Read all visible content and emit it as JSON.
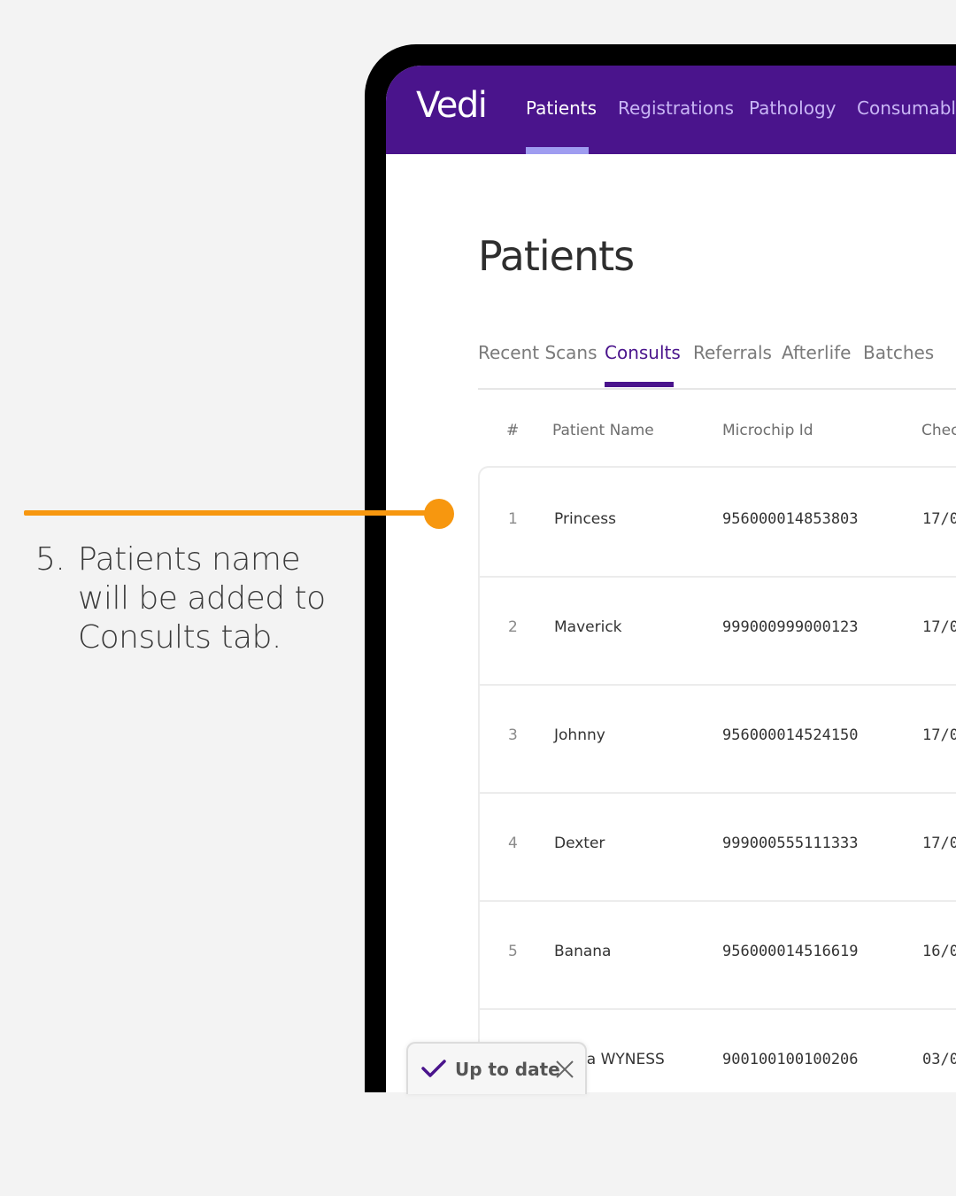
{
  "annotation": {
    "step": "5.",
    "lines": [
      "Patients name",
      "will be added to",
      "Consults tab."
    ]
  },
  "app": {
    "brand": "Vedi",
    "nav": [
      "Patients",
      "Registrations",
      "Pathology",
      "Consumable"
    ],
    "active_nav": "Patients"
  },
  "page": {
    "title": "Patients",
    "tabs": [
      "Recent Scans",
      "Consults",
      "Referrals",
      "Afterlife",
      "Batches"
    ],
    "active_tab": "Consults"
  },
  "table": {
    "headers": [
      "#",
      "Patient Name",
      "Microchip Id",
      "Chec"
    ],
    "rows": [
      {
        "index": "1",
        "name": "Princess",
        "microchip": "956000014853803",
        "date": "17/0"
      },
      {
        "index": "2",
        "name": "Maverick",
        "microchip": "999000999000123",
        "date": "17/0"
      },
      {
        "index": "3",
        "name": "Johnny",
        "microchip": "956000014524150",
        "date": "17/0"
      },
      {
        "index": "4",
        "name": "Dexter",
        "microchip": "999000555111333",
        "date": "17/0"
      },
      {
        "index": "5",
        "name": "Banana",
        "microchip": "956000014516619",
        "date": "16/0"
      },
      {
        "index": "",
        "name": "na WYNESS",
        "microchip": "900100100100206",
        "date": "03/0"
      }
    ]
  },
  "toast": {
    "label": "Up to date"
  },
  "colors": {
    "brand": "#4a148c",
    "accent": "#f7970f",
    "nav_underline": "#9f9cf0"
  }
}
